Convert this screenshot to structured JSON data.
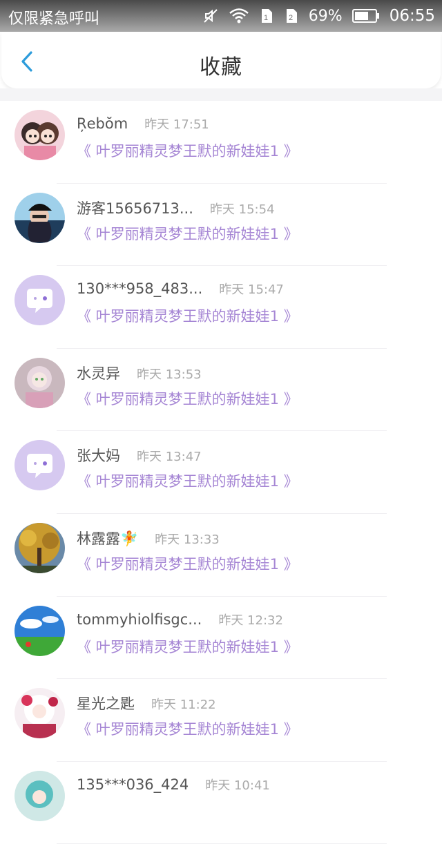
{
  "status_bar": {
    "carrier_text": "仅限紧急呼叫",
    "battery_percent": "69%",
    "time": "06:55",
    "icons": [
      "mute-icon",
      "wifi-icon",
      "sim1-icon",
      "sim2-icon",
      "battery-icon"
    ],
    "battery_level": 0.69
  },
  "header": {
    "title": "收藏",
    "back_icon": "chevron-left-icon",
    "accent_color": "#2d9cdb"
  },
  "colors": {
    "book_link": "#a585d4",
    "username": "#555555",
    "timestamp": "#aaaaaa",
    "default_avatar_bg": "#d6c9f0"
  },
  "favorites": [
    {
      "username": "Ŗebŏm",
      "time": "昨天 17:51",
      "book": "《 叶罗丽精灵梦王默的新娃娃1 》",
      "avatar": "anime-couple-avatar"
    },
    {
      "username": "游客15656713...",
      "time": "昨天 15:54",
      "book": "《 叶罗丽精灵梦王默的新娃娃1 》",
      "avatar": "girl-cap-avatar"
    },
    {
      "username": "130***958_483...",
      "time": "昨天 15:47",
      "book": "《 叶罗丽精灵梦王默的新娃娃1 》",
      "avatar": "default-chat-avatar"
    },
    {
      "username": "水灵异",
      "time": "昨天 13:53",
      "book": "《 叶罗丽精灵梦王默的新娃娃1 》",
      "avatar": "doll-avatar"
    },
    {
      "username": "张大妈",
      "time": "昨天 13:47",
      "book": "《 叶罗丽精灵梦王默的新娃娃1 》",
      "avatar": "default-chat-avatar"
    },
    {
      "username": "林露露🧚",
      "time": "昨天 13:33",
      "book": "《 叶罗丽精灵梦王默的新娃娃1 》",
      "avatar": "autumn-tree-avatar"
    },
    {
      "username": "tommyhiolfisgc...",
      "time": "昨天 12:32",
      "book": "《 叶罗丽精灵梦王默的新娃娃1 》",
      "avatar": "sky-field-avatar"
    },
    {
      "username": "星光之匙",
      "time": "昨天 11:22",
      "book": "《 叶罗丽精灵梦王默的新娃娃1 》",
      "avatar": "anime-girl-avatar"
    },
    {
      "username": "135***036_424",
      "time": "昨天 10:41",
      "book": "",
      "avatar": "teal-anime-avatar"
    }
  ]
}
